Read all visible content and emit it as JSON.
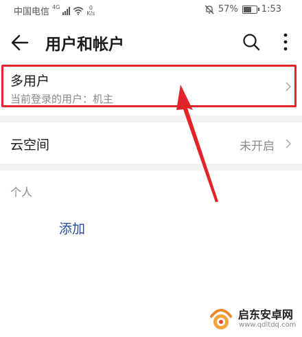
{
  "status_bar": {
    "carrier": "中国电信",
    "network_type": "4G",
    "speed_value": "0",
    "speed_unit": "K/s",
    "battery_percent": "57%",
    "battery_level": 0.57,
    "time": "1:53"
  },
  "app_bar": {
    "title": "用户和帐户",
    "icons": [
      "back-arrow-icon",
      "search-icon",
      "more-vertical-icon"
    ]
  },
  "multi_user": {
    "title": "多用户",
    "subtitle": "当前登录的用户：机主"
  },
  "cloud_space": {
    "title": "云空间",
    "value": "未开启"
  },
  "personal_section": {
    "label": "个人",
    "add_label": "添加"
  },
  "annotation": {
    "highlight_color": "#e0242a"
  },
  "watermark": {
    "brand": "启东安卓网",
    "url": "www.qdltdq.com"
  }
}
